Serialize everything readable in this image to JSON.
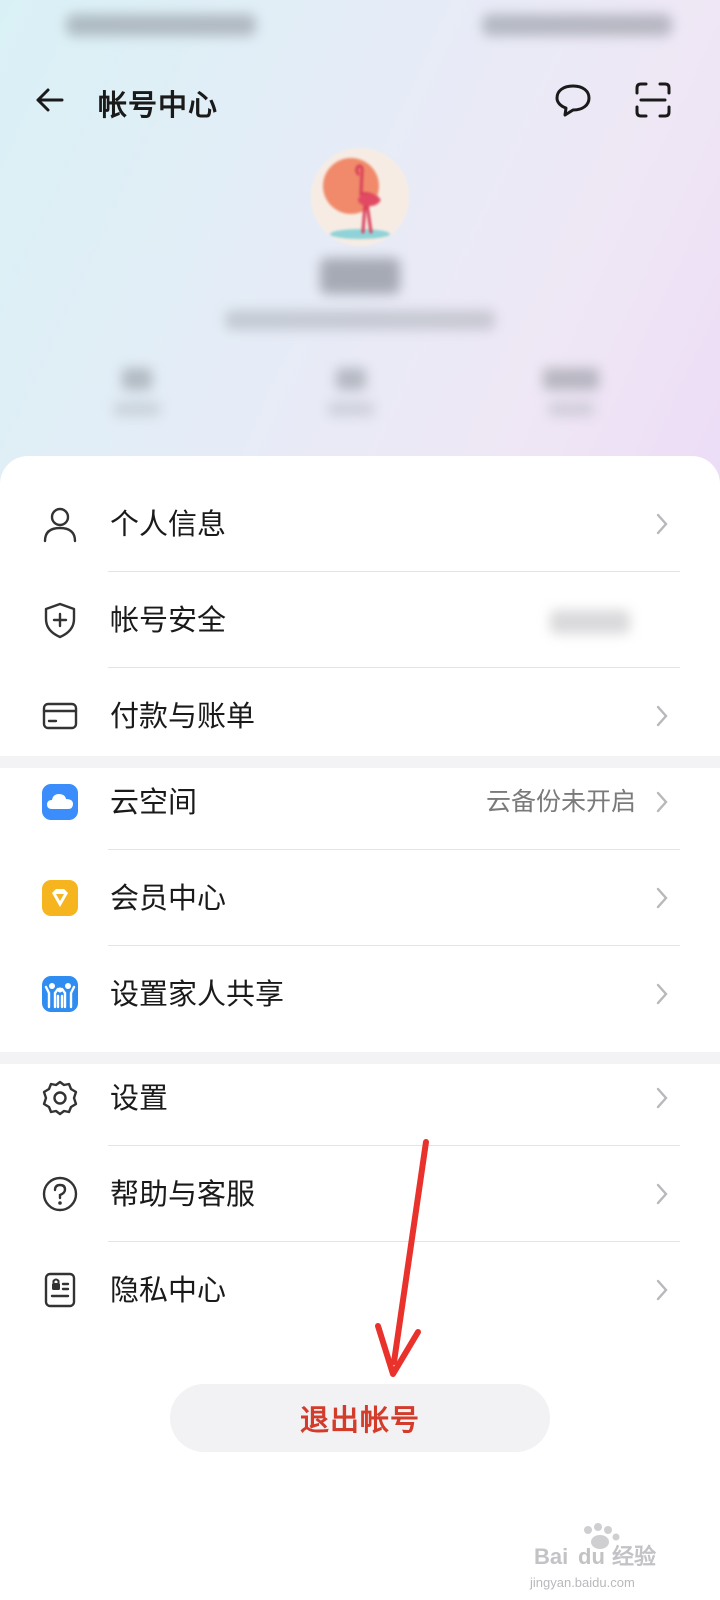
{
  "header": {
    "title": "帐号中心",
    "back_icon": "arrow-left-icon",
    "message_icon": "chat-bubble-icon",
    "scan_icon": "scan-icon"
  },
  "section1": {
    "items": [
      {
        "label": "个人信息",
        "icon": "person-icon"
      },
      {
        "label": "帐号安全",
        "icon": "shield-plus-icon"
      },
      {
        "label": "付款与账单",
        "icon": "card-icon"
      }
    ]
  },
  "section2": {
    "items": [
      {
        "label": "云空间",
        "value": "云备份未开启",
        "icon": "cloud-icon"
      },
      {
        "label": "会员中心",
        "icon": "diamond-icon"
      },
      {
        "label": "设置家人共享",
        "icon": "family-icon"
      }
    ]
  },
  "section3": {
    "items": [
      {
        "label": "设置",
        "icon": "gear-icon"
      },
      {
        "label": "帮助与客服",
        "icon": "question-icon"
      },
      {
        "label": "隐私中心",
        "icon": "privacy-icon"
      }
    ]
  },
  "logout_label": "退出帐号",
  "colors": {
    "accent_red": "#d33b2b",
    "annotation_arrow": "#e8322b"
  },
  "watermark": {
    "brand": "Bai du 经验",
    "url": "jingyan.baidu.com"
  }
}
